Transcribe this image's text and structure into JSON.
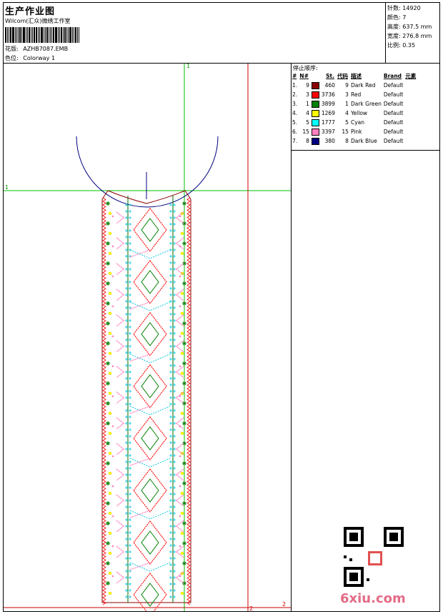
{
  "header": {
    "title": "生产作业图",
    "subtitle": "Wilcom(汇众)微绣工作室",
    "design_label": "花版:",
    "design_value": "AZHB7087.EMB",
    "colorway_label": "色位:",
    "colorway_value": "Colorway 1"
  },
  "stats": [
    {
      "label": "针数:",
      "value": "14920"
    },
    {
      "label": "颜色:",
      "value": "7"
    },
    {
      "label": "高度:",
      "value": "637.5 mm"
    },
    {
      "label": "宽度:",
      "value": "276.8 mm"
    },
    {
      "label": "比例:",
      "value": "0.35"
    }
  ],
  "stop_sequence": {
    "title": "停止顺序:",
    "headers": [
      "#",
      "N#",
      "St.",
      "代码",
      "描述",
      "Brand",
      "元素"
    ],
    "rows": [
      {
        "idx": "1.",
        "n": "9",
        "color": "#8b0000",
        "st": "460",
        "code": "9",
        "desc": "Dark Red",
        "brand": "Default"
      },
      {
        "idx": "2.",
        "n": "3",
        "color": "#ff0000",
        "st": "3736",
        "code": "3",
        "desc": "Red",
        "brand": "Default"
      },
      {
        "idx": "3.",
        "n": "1",
        "color": "#008000",
        "st": "3899",
        "code": "1",
        "desc": "Dark Green",
        "brand": "Default"
      },
      {
        "idx": "4.",
        "n": "4",
        "color": "#ffff00",
        "st": "1269",
        "code": "4",
        "desc": "Yellow",
        "brand": "Default"
      },
      {
        "idx": "5.",
        "n": "5",
        "color": "#00ffff",
        "st": "1777",
        "code": "5",
        "desc": "Cyan",
        "brand": "Default"
      },
      {
        "idx": "6.",
        "n": "15",
        "color": "#ff80c0",
        "st": "3397",
        "code": "15",
        "desc": "Pink",
        "brand": "Default"
      },
      {
        "idx": "7.",
        "n": "8",
        "color": "#000080",
        "st": "380",
        "code": "8",
        "desc": "Dark Blue",
        "brand": "Default"
      }
    ]
  },
  "guides": {
    "v1": "1",
    "h1": "1",
    "h2": "2",
    "v2": "2"
  },
  "watermark": {
    "site": "6xiu.com"
  }
}
